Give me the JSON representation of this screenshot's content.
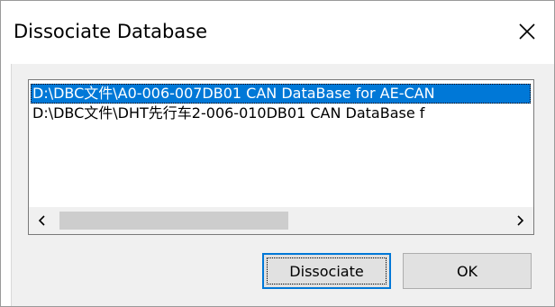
{
  "window": {
    "title": "Dissociate Database",
    "close_icon": "close-icon"
  },
  "listbox": {
    "items": [
      {
        "label": "D:\\DBC文件\\A0-006-007DB01  CAN DataBase for AE-CAN",
        "selected": true
      },
      {
        "label": "D:\\DBC文件\\DHT先行车2-006-010DB01  CAN DataBase f",
        "selected": false
      }
    ],
    "scrollbar": {
      "left_icon": "chevron-left-icon",
      "right_icon": "chevron-right-icon",
      "left_glyph": "<",
      "right_glyph": ">"
    }
  },
  "buttons": {
    "dissociate_label": "Dissociate",
    "ok_label": "OK"
  },
  "colors": {
    "selection": "#0078d7",
    "dialog_bg": "#f0f0f0",
    "button_bg": "#e1e1e1"
  }
}
